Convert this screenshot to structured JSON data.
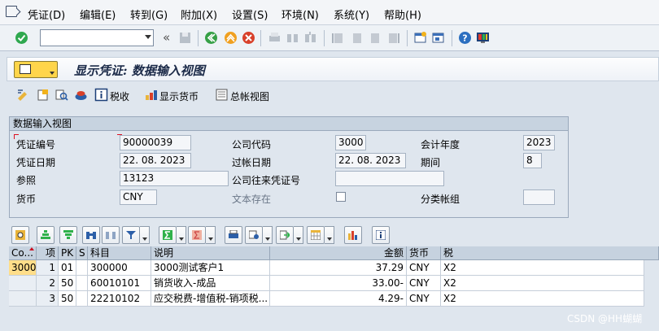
{
  "menu": [
    "凭证(D)",
    "编辑(E)",
    "转到(G)",
    "附加(X)",
    "设置(S)",
    "环境(N)",
    "系统(Y)",
    "帮助(H)"
  ],
  "okcode_value": "",
  "title": "显示凭证: 数据输入视图",
  "app_toolbar": {
    "tax": "税收",
    "show_currency": "显示货币",
    "ledger_view": "总帐视图"
  },
  "group": {
    "title": "数据输入视图",
    "doc_no_label": "凭证编号",
    "doc_no": "90000039",
    "company_label": "公司代码",
    "company": "3000",
    "fiscal_year_label": "会计年度",
    "fiscal_year": "2023",
    "doc_date_label": "凭证日期",
    "doc_date": "22. 08. 2023",
    "post_date_label": "过帐日期",
    "post_date": "22. 08. 2023",
    "period_label": "期间",
    "period": "8",
    "ref_label": "参照",
    "ref": "13123",
    "intercompany_label": "公司往来凭证号",
    "intercompany": "",
    "currency_label": "货币",
    "currency": "CNY",
    "text_exists_label": "文本存在",
    "ledger_group_label": "分类帐组",
    "ledger_group": ""
  },
  "grid": {
    "headers": [
      "Co...",
      "项",
      "PK",
      "S",
      "科目",
      "说明",
      "金额",
      "货币",
      "税"
    ],
    "rows": [
      [
        "3000",
        "1",
        "01",
        "",
        "300000",
        "3000测试客户1",
        "37.29",
        "CNY",
        "X2"
      ],
      [
        "",
        "2",
        "50",
        "",
        "60010101",
        "销货收入-成品",
        "33.00-",
        "CNY",
        "X2"
      ],
      [
        "",
        "3",
        "50",
        "",
        "22210102",
        "应交税费-增值税-销项税...",
        "4.29-",
        "CNY",
        "X2"
      ]
    ]
  },
  "watermark": "CSDN @HH蝴蝴"
}
